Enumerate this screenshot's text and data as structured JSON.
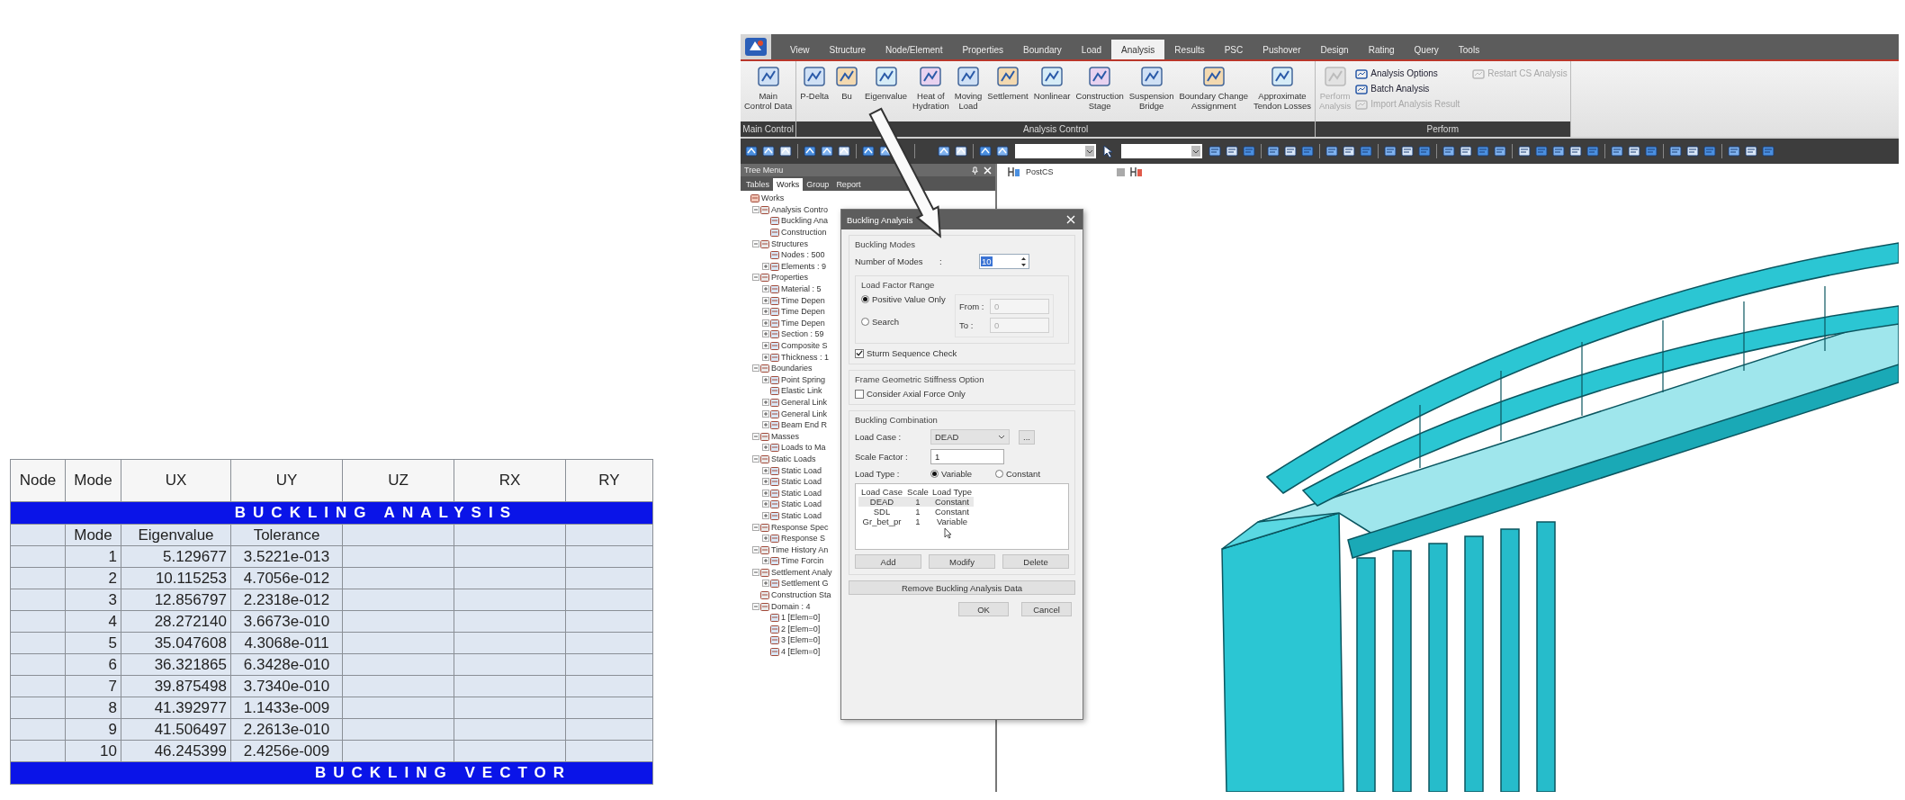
{
  "results_table": {
    "columns": [
      "Node",
      "Mode",
      "UX",
      "UY",
      "UZ",
      "RX",
      "RY"
    ],
    "section_title": "BUCKLING   ANALYSIS",
    "subheader": [
      "Mode",
      "Eigenvalue",
      "Tolerance"
    ],
    "rows": [
      {
        "mode": "1",
        "eigenvalue": "5.129677",
        "tolerance": "3.5221e-013"
      },
      {
        "mode": "2",
        "eigenvalue": "10.115253",
        "tolerance": "4.7056e-012"
      },
      {
        "mode": "3",
        "eigenvalue": "12.856797",
        "tolerance": "2.2318e-012"
      },
      {
        "mode": "4",
        "eigenvalue": "28.272140",
        "tolerance": "3.6673e-010"
      },
      {
        "mode": "5",
        "eigenvalue": "35.047608",
        "tolerance": "4.3068e-011"
      },
      {
        "mode": "6",
        "eigenvalue": "36.321865",
        "tolerance": "6.3428e-010"
      },
      {
        "mode": "7",
        "eigenvalue": "39.875498",
        "tolerance": "3.7340e-010"
      },
      {
        "mode": "8",
        "eigenvalue": "41.392977",
        "tolerance": "1.1433e-009"
      },
      {
        "mode": "9",
        "eigenvalue": "41.506497",
        "tolerance": "2.2613e-010"
      },
      {
        "mode": "10",
        "eigenvalue": "46.245399",
        "tolerance": "2.4256e-009"
      }
    ],
    "footer_title": "BUCKLING VECTOR"
  },
  "menu_tabs": [
    {
      "label": "View",
      "selected": false
    },
    {
      "label": "Structure",
      "selected": false
    },
    {
      "label": "Node/Element",
      "selected": false
    },
    {
      "label": "Properties",
      "selected": false
    },
    {
      "label": "Boundary",
      "selected": false
    },
    {
      "label": "Load",
      "selected": false
    },
    {
      "label": "Analysis",
      "selected": true
    },
    {
      "label": "Results",
      "selected": false
    },
    {
      "label": "PSC",
      "selected": false
    },
    {
      "label": "Pushover",
      "selected": false
    },
    {
      "label": "Design",
      "selected": false
    },
    {
      "label": "Rating",
      "selected": false
    },
    {
      "label": "Query",
      "selected": false
    },
    {
      "label": "Tools",
      "selected": false
    }
  ],
  "ribbon_groups": [
    {
      "kind": "large",
      "label": "Main Control",
      "buttons": [
        {
          "label": "Main\nControl Data",
          "disabled": false
        }
      ]
    },
    {
      "kind": "large",
      "label": "Analysis Control",
      "buttons": [
        {
          "label": "P-Delta",
          "disabled": false
        },
        {
          "label": "Bu",
          "disabled": false
        },
        {
          "label": "Eigenvalue",
          "disabled": false
        },
        {
          "label": "Heat of\nHydration",
          "disabled": false
        },
        {
          "label": "Moving\nLoad",
          "disabled": false
        },
        {
          "label": "Settlement",
          "disabled": false
        },
        {
          "label": "Nonlinear",
          "disabled": false
        },
        {
          "label": "Construction\nStage",
          "disabled": false
        },
        {
          "label": "Suspension\nBridge",
          "disabled": false
        },
        {
          "label": "Boundary Change\nAssignment",
          "disabled": false
        },
        {
          "label": "Approximate\nTendon Losses",
          "disabled": false
        }
      ]
    },
    {
      "kind": "perform",
      "label": "Perform",
      "buttons": [
        {
          "label": "Perform\nAnalysis",
          "disabled": true
        }
      ],
      "small_buttons": [
        {
          "label": "Analysis Options",
          "disabled": false
        },
        {
          "label": "Batch Analysis",
          "disabled": false
        },
        {
          "label": "Import Analysis Result",
          "disabled": true
        },
        {
          "label": "Restart CS Analysis",
          "disabled": true
        }
      ]
    }
  ],
  "tree_menu": {
    "title": "Tree Menu",
    "tabs": [
      {
        "label": "Tables",
        "selected": false
      },
      {
        "label": "Works",
        "selected": true
      },
      {
        "label": "Group",
        "selected": false
      },
      {
        "label": "Report",
        "selected": false
      }
    ],
    "items": [
      {
        "label": "Works",
        "kind": "leaf",
        "children": [
          {
            "label": "Analysis Contro",
            "kind": "branch",
            "expanded": true,
            "children": [
              {
                "label": "Buckling Ana",
                "kind": "leaf"
              },
              {
                "label": "Construction",
                "kind": "leaf"
              }
            ]
          },
          {
            "label": "Structures",
            "kind": "branch",
            "expanded": true,
            "children": [
              {
                "label": "Nodes : 500",
                "kind": "leaf"
              },
              {
                "label": "Elements : 9",
                "kind": "branch",
                "expanded": false
              }
            ]
          },
          {
            "label": "Properties",
            "kind": "branch",
            "expanded": true,
            "children": [
              {
                "label": "Material : 5",
                "kind": "branch",
                "expanded": false
              },
              {
                "label": "Time Depen",
                "kind": "branch",
                "expanded": false
              },
              {
                "label": "Time Depen",
                "kind": "branch",
                "expanded": false
              },
              {
                "label": "Time Depen",
                "kind": "branch",
                "expanded": false
              },
              {
                "label": "Section : 59",
                "kind": "branch",
                "expanded": false
              },
              {
                "label": "Composite S",
                "kind": "branch",
                "expanded": false
              },
              {
                "label": "Thickness : 1",
                "kind": "branch",
                "expanded": false
              }
            ]
          },
          {
            "label": "Boundaries",
            "kind": "branch",
            "expanded": true,
            "children": [
              {
                "label": "Point Spring",
                "kind": "branch",
                "expanded": false
              },
              {
                "label": "Elastic Link",
                "kind": "leaf"
              },
              {
                "label": "General Link",
                "kind": "branch",
                "expanded": false
              },
              {
                "label": "General Link",
                "kind": "branch",
                "expanded": false
              },
              {
                "label": "Beam End R",
                "kind": "branch",
                "expanded": false
              }
            ]
          },
          {
            "label": "Masses",
            "kind": "branch",
            "expanded": true,
            "children": [
              {
                "label": "Loads to Ma",
                "kind": "branch",
                "expanded": false
              }
            ]
          },
          {
            "label": "Static Loads",
            "kind": "branch",
            "expanded": true,
            "children": [
              {
                "label": "Static Load",
                "kind": "branch",
                "expanded": false
              },
              {
                "label": "Static Load",
                "kind": "branch",
                "expanded": false
              },
              {
                "label": "Static Load",
                "kind": "branch",
                "expanded": false
              },
              {
                "label": "Static Load",
                "kind": "branch",
                "expanded": false
              },
              {
                "label": "Static Load",
                "kind": "branch",
                "expanded": false
              }
            ]
          },
          {
            "label": "Response Spec",
            "kind": "branch",
            "expanded": true,
            "children": [
              {
                "label": "Response S",
                "kind": "branch",
                "expanded": false
              }
            ]
          },
          {
            "label": "Time History An",
            "kind": "branch",
            "expanded": true,
            "children": [
              {
                "label": "Time Forcin",
                "kind": "branch",
                "expanded": false
              }
            ]
          },
          {
            "label": "Settlement Analy",
            "kind": "branch",
            "expanded": true,
            "children": [
              {
                "label": "Settlement G",
                "kind": "branch",
                "expanded": false
              }
            ]
          },
          {
            "label": "Construction Sta",
            "kind": "leaf"
          },
          {
            "label": "Domain : 4",
            "kind": "branch",
            "expanded": true,
            "children": [
              {
                "label": "1 [Elem=0]",
                "kind": "leaf"
              },
              {
                "label": "2 [Elem=0]",
                "kind": "leaf"
              },
              {
                "label": "3 [Elem=0]",
                "kind": "leaf"
              },
              {
                "label": "4 [Elem=0]",
                "kind": "leaf"
              }
            ]
          }
        ]
      }
    ]
  },
  "viewport": {
    "view_name": "PostCS"
  },
  "dialog": {
    "title": "Buckling Analysis",
    "modes_group": {
      "title": "Buckling Modes",
      "label": "Number of Modes",
      "colon": ":",
      "value": "10"
    },
    "range_group": {
      "title": "Load Factor Range",
      "options": [
        {
          "label": "Positive Value Only",
          "selected": true
        },
        {
          "label": "Search",
          "selected": false
        }
      ],
      "from_label": "From :",
      "from_value": "0",
      "to_label": "To :",
      "to_value": "0",
      "fields_disabled": true
    },
    "sturm": {
      "label": "Sturm Sequence Check",
      "checked": true
    },
    "geometric_group": {
      "title": "Frame Geometric Stiffness Option",
      "option": {
        "label": "Consider Axial Force Only",
        "checked": false
      }
    },
    "combination_group": {
      "title": "Buckling Combination",
      "load_case_label": "Load Case :",
      "load_case_value": "DEAD",
      "browse_button": "...",
      "scale_label": "Scale Factor :",
      "scale_value": "1",
      "load_type_label": "Load Type :",
      "load_types": [
        {
          "label": "Variable",
          "selected": true
        },
        {
          "label": "Constant",
          "selected": false
        }
      ],
      "list": {
        "columns": [
          "Load Case",
          "Scale",
          "Load Type"
        ],
        "rows": [
          {
            "cells": [
              "DEAD",
              "1",
              "Constant"
            ],
            "selected": true
          },
          {
            "cells": [
              "SDL",
              "1",
              "Constant"
            ],
            "selected": false
          },
          {
            "cells": [
              "Gr_bet_pr",
              "1",
              "Variable"
            ],
            "selected": false
          }
        ]
      },
      "buttons": [
        "Add",
        "Modify",
        "Delete"
      ]
    },
    "remove_button": "Remove Buckling Analysis Data",
    "buttons": [
      "OK",
      "Cancel"
    ]
  }
}
